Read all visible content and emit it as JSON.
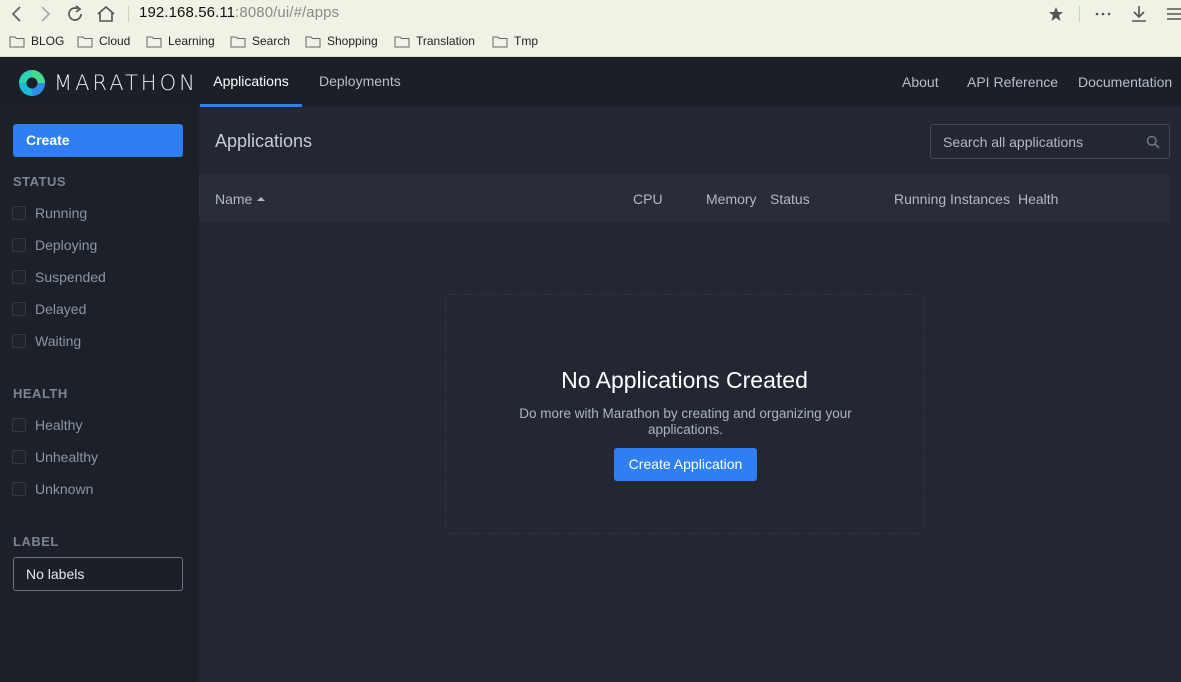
{
  "browser": {
    "url_host": "192.168.56.11",
    "url_rest": ":8080/ui/#/apps",
    "bookmarks": [
      "BLOG",
      "Cloud",
      "Learning",
      "Search",
      "Shopping",
      "Translation",
      "Tmp"
    ]
  },
  "header": {
    "logo_text": "MARATHON",
    "tabs": [
      {
        "label": "Applications",
        "active": true
      },
      {
        "label": "Deployments",
        "active": false
      }
    ],
    "links": [
      "About",
      "API Reference",
      "Documentation"
    ]
  },
  "sidebar": {
    "create_label": "Create",
    "status_title": "STATUS",
    "status_filters": [
      "Running",
      "Deploying",
      "Suspended",
      "Delayed",
      "Waiting"
    ],
    "health_title": "HEALTH",
    "health_filters": [
      "Healthy",
      "Unhealthy",
      "Unknown"
    ],
    "label_title": "LABEL",
    "label_value": "No labels"
  },
  "main": {
    "title": "Applications",
    "search_placeholder": "Search all applications",
    "columns": [
      "Name",
      "CPU",
      "Memory",
      "Status",
      "Running Instances",
      "Health"
    ],
    "empty_title": "No Applications Created",
    "empty_desc": "Do more with Marathon by creating and organizing your applications.",
    "create_app_label": "Create Application"
  },
  "colors": {
    "accent": "#2f7ff2",
    "background": "#222731",
    "sidebar": "#1c2029"
  }
}
